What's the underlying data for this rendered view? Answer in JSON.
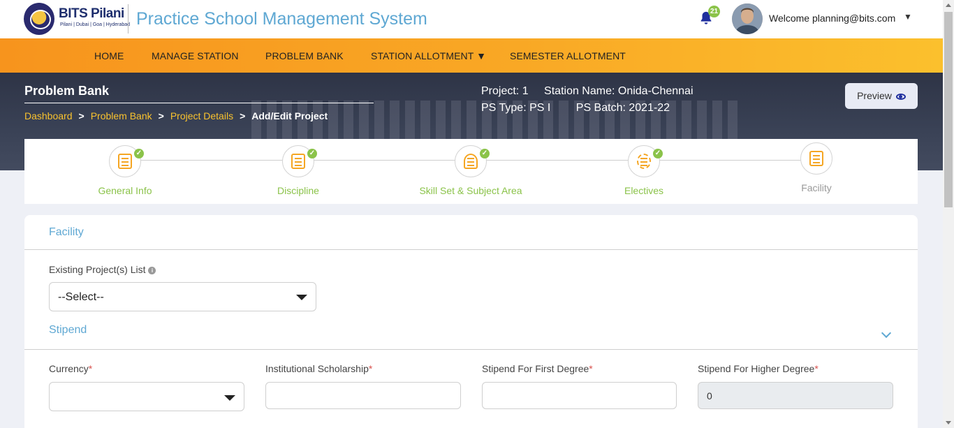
{
  "header": {
    "brand": "BITS Pilani",
    "brand_sub": "Pilani | Dubai | Goa | Hyderabad",
    "app_title": "Practice School Management System",
    "notification_count": "21",
    "welcome_text": "Welcome planning@bits.com",
    "user_caret": "▼"
  },
  "nav": {
    "items": [
      {
        "label": "HOME"
      },
      {
        "label": "MANAGE STATION"
      },
      {
        "label": "PROBLEM BANK"
      },
      {
        "label": "STATION ALLOTMENT ▼"
      },
      {
        "label": "SEMESTER ALLOTMENT"
      }
    ]
  },
  "banner": {
    "title": "Problem Bank",
    "breadcrumb": [
      {
        "label": "Dashboard"
      },
      {
        "label": "Problem Bank"
      },
      {
        "label": "Project Details"
      },
      {
        "label": "Add/Edit Project"
      }
    ],
    "separator": ">",
    "project": "Project: 1",
    "station_name": "Station Name: Onida-Chennai",
    "ps_type": "PS Type: PS I",
    "ps_batch": "PS Batch: 2021-22",
    "preview_label": "Preview"
  },
  "stepper": {
    "steps": [
      {
        "label": "General Info",
        "icon": "document-check-icon",
        "done": true
      },
      {
        "label": "Discipline",
        "icon": "certificate-icon",
        "done": true
      },
      {
        "label": "Skill Set & Subject Area",
        "icon": "compass-icon",
        "done": true
      },
      {
        "label": "Electives",
        "icon": "gear-icon",
        "done": true
      },
      {
        "label": "Facility",
        "icon": "building-icon",
        "done": false
      }
    ]
  },
  "form": {
    "facility_title": "Facility",
    "existing_projects_label": "Existing Project(s) List",
    "existing_projects_value": "--Select--",
    "stipend_title": "Stipend",
    "currency_label": "Currency",
    "currency_value": "",
    "scholarship_label": "Institutional Scholarship",
    "scholarship_value": "",
    "first_degree_label": "Stipend For First Degree",
    "first_degree_value": "",
    "higher_degree_label": "Stipend For Higher Degree",
    "higher_degree_value": "0",
    "required_mark": "*"
  },
  "colors": {
    "accent_blue": "#5fa8d3",
    "nav_orange": "#f7941d",
    "success_green": "#8bc34a",
    "breadcrumb_yellow": "#f9c22e"
  }
}
